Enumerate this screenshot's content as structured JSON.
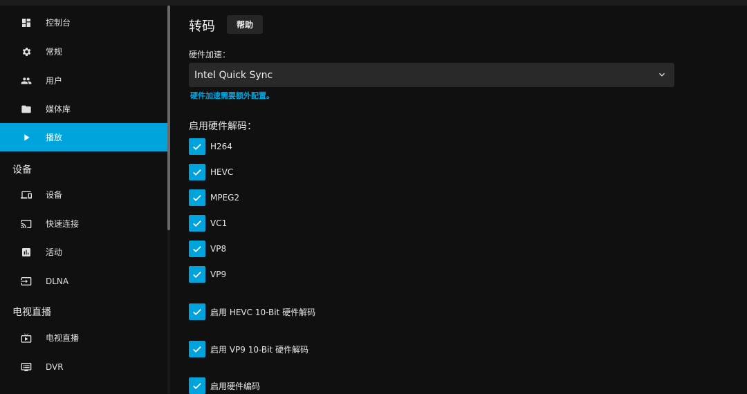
{
  "sidebar": {
    "items": [
      {
        "label": "控制台",
        "icon": "dashboard-icon"
      },
      {
        "label": "常规",
        "icon": "gear-icon"
      },
      {
        "label": "用户",
        "icon": "users-icon"
      },
      {
        "label": "媒体库",
        "icon": "folder-icon"
      },
      {
        "label": "播放",
        "icon": "play-icon",
        "active": true
      }
    ],
    "devices_header": "设备",
    "devices_items": [
      {
        "label": "设备",
        "icon": "devices-icon"
      },
      {
        "label": "快速连接",
        "icon": "cast-icon"
      },
      {
        "label": "活动",
        "icon": "activity-icon"
      },
      {
        "label": "DLNA",
        "icon": "input-icon"
      }
    ],
    "livetv_header": "电视直播",
    "livetv_items": [
      {
        "label": "电视直播",
        "icon": "live-tv-icon"
      },
      {
        "label": "DVR",
        "icon": "dvr-icon"
      }
    ]
  },
  "main": {
    "title": "转码",
    "help_label": "帮助",
    "hw_accel_label": "硬件加速：",
    "hw_accel_value": "Intel Quick Sync",
    "hw_accel_hint": "硬件加速需要额外配置。",
    "decode_label": "启用硬件解码：",
    "codecs": [
      "H264",
      "HEVC",
      "MPEG2",
      "VC1",
      "VP8",
      "VP9"
    ],
    "options": [
      "启用 HEVC 10-Bit 硬件解码",
      "启用 VP9 10-Bit 硬件解码",
      "启用硬件编码"
    ]
  },
  "colors": {
    "accent": "#00a4dc",
    "background": "#101010",
    "input_bg": "#292929"
  }
}
